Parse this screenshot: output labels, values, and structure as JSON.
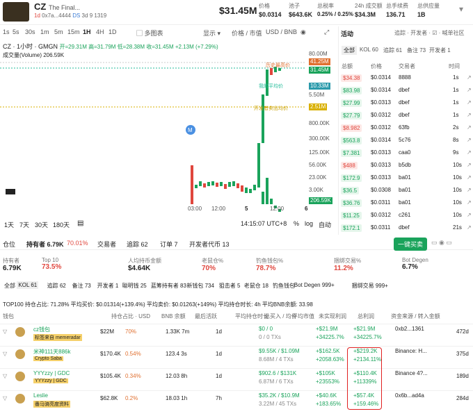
{
  "token": {
    "name": "CZ",
    "full": "The Final...",
    "age": "1d",
    "address": "0x7a...4444",
    "holders_badge": "DS",
    "badge_3d": "3d",
    "count_9": "9",
    "count_1319": "1319"
  },
  "header": {
    "price": "$31.45M",
    "stats": [
      {
        "label": "价格",
        "value": "$0.0314"
      },
      {
        "label": "池子",
        "value": "$643.6K"
      },
      {
        "label": "总税率",
        "value": "0.25% / 0.25%"
      },
      {
        "label": "24h 成交额",
        "value": "$34.3M"
      },
      {
        "label": "总手续费",
        "value": "136.71"
      },
      {
        "label": "总供应量",
        "value": "1B"
      }
    ]
  },
  "toolbar": {
    "intervals": [
      "1s",
      "5s",
      "30s",
      "1m",
      "5m",
      "15m",
      "1H",
      "4H",
      "1D"
    ],
    "active": "1H",
    "multi": "多图表",
    "display": "显示",
    "price_cap": "价格 / 市值",
    "currency": "USD / BNB"
  },
  "chart": {
    "title": "CZ · 1小时 · GMGN",
    "ohlc": "开=29.31M 高=31.79M 低=28.38M 收=31.45M +2.13M (+7.29%)",
    "volume": "成交量(Volume)  206.59K",
    "yticks": [
      "80.00M",
      "41.25M",
      "31.45M",
      "10.33M",
      "5.50M",
      "2.51M",
      "800.00K",
      "300.00K",
      "125.00K",
      "56.00K",
      "23.00K",
      "206.59K",
      "3.00K"
    ],
    "xticks": [
      "03:00",
      "12:00",
      "5",
      "12:00",
      "6"
    ],
    "time": "14:15:07 UTC+8",
    "ranges": [
      "1天",
      "7天",
      "30天",
      "180天"
    ],
    "pct": "%",
    "log": "log",
    "auto": "自动",
    "ann": [
      "历史最高价",
      "我的平均价",
      "开发者卖出均价"
    ]
  },
  "activity": {
    "title": "活动",
    "tabs": [
      "全部",
      "KOL 60",
      "追踪 61",
      "备注 73",
      "开发者 1"
    ],
    "cols": [
      "总额",
      "价格",
      "交易者",
      "时间"
    ],
    "rows": [
      {
        "amt": "$34.38",
        "p": "$0.0314",
        "t": "8888",
        "tm": "1s",
        "buy": false
      },
      {
        "amt": "$83.98",
        "p": "$0.0314",
        "t": "dbef",
        "tm": "1s",
        "buy": true
      },
      {
        "amt": "$27.99",
        "p": "$0.0313",
        "t": "dbef",
        "tm": "1s",
        "buy": true
      },
      {
        "amt": "$27.79",
        "p": "$0.0312",
        "t": "dbef",
        "tm": "1s",
        "buy": true
      },
      {
        "amt": "$8.982",
        "p": "$0.0312",
        "t": "63fb",
        "tm": "2s",
        "buy": false
      },
      {
        "amt": "$563.8",
        "p": "$0.0314",
        "t": "5c76",
        "tm": "8s",
        "buy": true
      },
      {
        "amt": "$7.381",
        "p": "$0.0313",
        "t": "caa0",
        "tm": "9s",
        "buy": true
      },
      {
        "amt": "$488",
        "p": "$0.0313",
        "t": "b5db",
        "tm": "10s",
        "buy": false
      },
      {
        "amt": "$172.9",
        "p": "$0.0313",
        "t": "ba01",
        "tm": "10s",
        "buy": true
      },
      {
        "amt": "$36.5",
        "p": "$0.0308",
        "t": "ba01",
        "tm": "10s",
        "buy": true
      },
      {
        "amt": "$36.76",
        "p": "$0.0311",
        "t": "ba01",
        "tm": "10s",
        "buy": true
      },
      {
        "amt": "$11.25",
        "p": "$0.0312",
        "t": "c261",
        "tm": "10s",
        "buy": true
      },
      {
        "amt": "$172.1",
        "p": "$0.0311",
        "t": "dbef",
        "tm": "21s",
        "buy": true
      }
    ]
  },
  "pos_tabs": [
    "仓位",
    "持有者 6.79K",
    "70.01%",
    "交易者",
    "追踪 62",
    "订单 7",
    "开发者代币 13"
  ],
  "buy_btn": "一键买卖",
  "metrics": [
    {
      "l": "持有者",
      "v": "6.79K"
    },
    {
      "l": "Top 10",
      "v": "73.5%"
    },
    {
      "l": "人均持币金额",
      "v": "$4.64K"
    },
    {
      "l": "老鼠仓%",
      "v": "70%"
    },
    {
      "l": "钓鱼钱包%",
      "v": "78.7%"
    },
    {
      "l": "捆绑交易%",
      "v": "11.2%"
    },
    {
      "l": "Bot Degen",
      "v": "6.7%"
    }
  ],
  "filters": [
    "全部",
    "KOL 61",
    "追踪 62",
    "备注 73",
    "开发者 1",
    "聪明钱 25",
    "蓝筹持有者 83",
    "新钱包 734",
    "狙击者 5",
    "老鼠仓 18",
    "钓鱼钱包",
    "Bot Degen 999+",
    "捆绑交易 999+"
  ],
  "top100": "TOP100  持仓占比: 71.28%  平均买价: $0.01314(+139.4%)  平均卖价: $0.01263(+149%)  平均持仓时长: 4h  平均BNB余额: 33.98",
  "table_cols": [
    "钱包",
    "持仓占比 · USD",
    "BNB 余额",
    "最后活跃",
    "平均持仓时长",
    "总买入 / 均价",
    "平均市值",
    "未实现利润",
    "总利润",
    "资金来源 / 转入金额"
  ],
  "holders": [
    {
      "name": "cz钱包",
      "tag": "标签来自 memeradar",
      "usd": "$22M",
      "pct": "70%",
      "bnb": "1.33K",
      "age": "7m",
      "dur": "1d",
      "buy": "$0 / 0",
      "tx": "0 / 0 TXs",
      "pnl": "+$21.9M",
      "pnlp": "+34225.7%",
      "tp": "+$21.9M",
      "tpp": "+34225.7%",
      "src": "0xb2...1361",
      "src2": "472d"
    },
    {
      "name": "米神111天886k",
      "tag": "Crypto Saba",
      "usd": "$170.4K",
      "pct": "0.54%",
      "bnb": "123.4",
      "age": "3s",
      "dur": "1d",
      "buy": "$9.55K / $1.09M",
      "tx": "8.68M / 4 TXs",
      "pnl": "+$162.5K",
      "pnlp": "+2058.63%",
      "tp": "+$219.2K",
      "tpp": "+2134.11%",
      "src": "Binance: H...",
      "src2": "375d"
    },
    {
      "name": "YYYzzy | GDC",
      "tag": "YYYzzy | GDC",
      "usd": "$105.4K",
      "pct": "0.34%",
      "bnb": "12.03",
      "age": "8h",
      "dur": "1d",
      "buy": "$902.6 / $131K",
      "tx": "6.87M / 6 TXs",
      "pnl": "+$105K",
      "pnlp": "+23553%",
      "tp": "+$110.4K",
      "tpp": "+11339%",
      "src": "Binance 4?...",
      "src2": "189d"
    },
    {
      "name": "Leslie",
      "tag": "番马骑亮度资料",
      "usd": "$62.8K",
      "pct": "0.2%",
      "bnb": "18.03",
      "age": "1h",
      "dur": "7h",
      "buy": "$35.2K / $10.9M",
      "tx": "3.22M / 45 TXs",
      "pnl": "+$40.6K",
      "pnlp": "+183.65%",
      "tp": "+$57.4K",
      "tpp": "+159.46%",
      "src": "0x6b...ad4a",
      "src2": "284d"
    }
  ]
}
